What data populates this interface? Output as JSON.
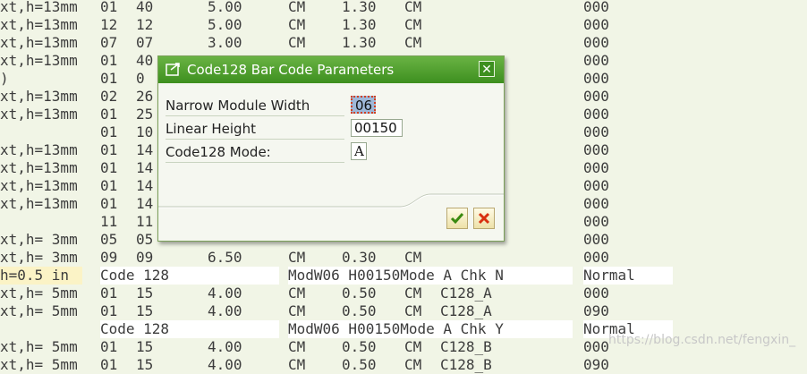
{
  "listing": {
    "rows": [
      [
        "xt,h=13mm",
        "01",
        "40",
        "5.00",
        "CM",
        "1.30",
        "CM",
        "",
        "",
        "",
        "000"
      ],
      [
        "xt,h=13mm",
        "12",
        "12",
        "5.00",
        "CM",
        "1.30",
        "CM",
        "",
        "",
        "",
        "000"
      ],
      [
        "xt,h=13mm",
        "07",
        "07",
        "3.00",
        "CM",
        "1.30",
        "CM",
        "",
        "",
        "",
        "000"
      ],
      [
        "xt,h=13mm",
        "01",
        "40",
        "",
        "",
        "",
        "",
        "",
        "",
        "",
        "000"
      ],
      [
        ")",
        "01",
        "0",
        "",
        "",
        "",
        "",
        "",
        "",
        "",
        "000"
      ],
      [
        "xt,h=13mm",
        "02",
        "26",
        "",
        "",
        "",
        "",
        "",
        "",
        "",
        "000"
      ],
      [
        "xt,h=13mm",
        "01",
        "25",
        "",
        "",
        "",
        "",
        "",
        "",
        "",
        "000"
      ],
      [
        "",
        "01",
        "10",
        "",
        "",
        "",
        "",
        "",
        "",
        "",
        "000"
      ],
      [
        "xt,h=13mm",
        "01",
        "14",
        "",
        "",
        "",
        "",
        "",
        "",
        "",
        "000"
      ],
      [
        "xt,h=13mm",
        "01",
        "14",
        "",
        "",
        "",
        "",
        "",
        "",
        "",
        "000"
      ],
      [
        "xt,h=13mm",
        "01",
        "14",
        "",
        "",
        "",
        "",
        "",
        "",
        "",
        "000"
      ],
      [
        "xt,h=13mm",
        "01",
        "14",
        "",
        "",
        "",
        "",
        "",
        "",
        "",
        "000"
      ],
      [
        "",
        "11",
        "11",
        "",
        "",
        "",
        "",
        "",
        "",
        "",
        "000"
      ],
      [
        "xt,h= 3mm",
        "05",
        "05",
        "",
        "",
        "",
        "",
        "",
        "",
        "",
        "000"
      ],
      [
        "xt,h= 3mm",
        "09",
        "09",
        "6.50",
        "CM",
        "0.30",
        "CM",
        "",
        "",
        "",
        "000"
      ],
      [
        "h=0.5 in",
        "Code 128",
        "",
        "",
        "ModW06 H00150Mode A Chk N",
        "",
        "",
        "",
        "",
        "",
        "Normal"
      ],
      [
        "xt,h= 5mm",
        "01",
        "15",
        "4.00",
        "CM",
        "0.50",
        "CM",
        "C128_A",
        "",
        "",
        "000"
      ],
      [
        "xt,h= 5mm",
        "01",
        "15",
        "4.00",
        "CM",
        "0.50",
        "CM",
        "C128_A",
        "",
        "",
        "090"
      ],
      [
        "",
        "Code 128",
        "",
        "",
        "ModW06 H00150Mode A Chk Y",
        "",
        "",
        "",
        "",
        "",
        "Normal"
      ],
      [
        "xt,h= 5mm",
        "01",
        "15",
        "4.00",
        "CM",
        "0.50",
        "CM",
        "C128_B",
        "",
        "",
        "000"
      ],
      [
        "xt,h= 5mm",
        "01",
        "15",
        "4.00",
        "CM",
        "0.50",
        "CM",
        "C128_B",
        "",
        "",
        "090"
      ]
    ],
    "highlight_rows": [
      15,
      18
    ]
  },
  "dialog": {
    "title": "Code128 Bar Code Parameters",
    "fields": [
      {
        "label": "Narrow Module Width",
        "value": "06"
      },
      {
        "label": "Linear Height",
        "value": "00150"
      },
      {
        "label": "Code128 Mode:",
        "value": "A"
      }
    ],
    "icons": {
      "title": "dialog-window-icon",
      "close": "close-icon",
      "ok": "checkmark-icon",
      "cancel": "cancel-x-icon"
    },
    "colors": {
      "titlebar": "#4a9a2a",
      "ok": "#3a8a10",
      "cancel": "#d83010"
    }
  },
  "watermark": "https://blog.csdn.net/fengxin_"
}
